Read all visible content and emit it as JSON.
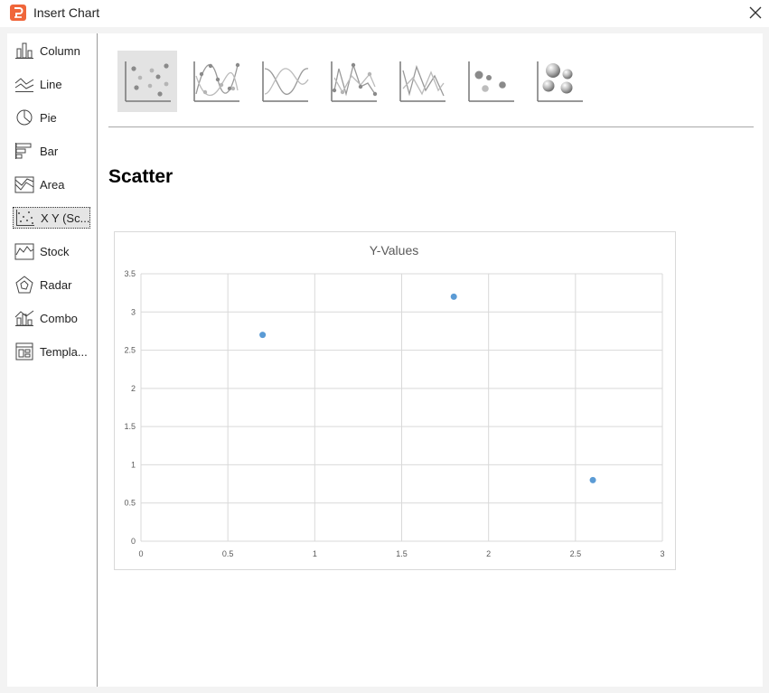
{
  "window": {
    "title": "Insert Chart",
    "app_icon": "presentation-app-icon",
    "close_icon": "close-icon",
    "brand_color": "#f0663a"
  },
  "sidebar": {
    "items": [
      {
        "label": "Column",
        "icon": "column-chart-icon"
      },
      {
        "label": "Line",
        "icon": "line-chart-icon"
      },
      {
        "label": "Pie",
        "icon": "pie-chart-icon"
      },
      {
        "label": "Bar",
        "icon": "bar-chart-icon"
      },
      {
        "label": "Area",
        "icon": "area-chart-icon"
      },
      {
        "label": "X Y (Sc...",
        "icon": "xy-scatter-chart-icon",
        "selected": true
      },
      {
        "label": "Stock",
        "icon": "stock-chart-icon"
      },
      {
        "label": "Radar",
        "icon": "radar-chart-icon"
      },
      {
        "label": "Combo",
        "icon": "combo-chart-icon"
      },
      {
        "label": "Templa...",
        "icon": "template-chart-icon"
      }
    ]
  },
  "gallery": {
    "subtypes": [
      {
        "icon": "scatter-markers-icon",
        "selected": true
      },
      {
        "icon": "scatter-smooth-lines-markers-icon"
      },
      {
        "icon": "scatter-smooth-lines-icon"
      },
      {
        "icon": "scatter-straight-lines-markers-icon"
      },
      {
        "icon": "scatter-straight-lines-icon"
      },
      {
        "icon": "bubble-icon"
      },
      {
        "icon": "3d-bubble-icon"
      }
    ]
  },
  "preview": {
    "subtype_title": "Scatter"
  },
  "chart_data": {
    "type": "scatter",
    "title": "Y-Values",
    "xlabel": "",
    "ylabel": "",
    "xlim": [
      0,
      3
    ],
    "ylim": [
      0,
      3.5
    ],
    "xticks": [
      "0",
      "0.5",
      "1",
      "1.5",
      "2",
      "2.5",
      "3"
    ],
    "yticks": [
      "0",
      "0.5",
      "1",
      "1.5",
      "2",
      "2.5",
      "3",
      "3.5"
    ],
    "grid": true,
    "legend": "none",
    "series": [
      {
        "x": [
          0.7,
          1.8,
          2.6
        ],
        "y": [
          2.7,
          3.2,
          0.8
        ],
        "color": "#5b9bd5"
      }
    ],
    "colors": {
      "gridline": "#d9d9d9",
      "tick_label": "#595959",
      "title": "#595959"
    }
  }
}
